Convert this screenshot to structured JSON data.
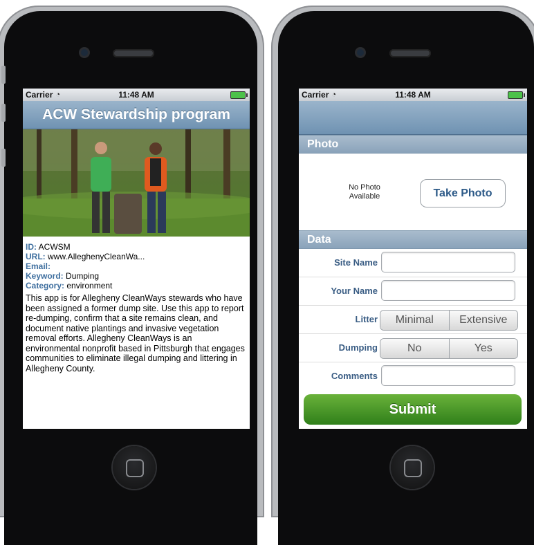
{
  "left_screen": {
    "status": {
      "carrier": "Carrier",
      "time": "11:48 AM"
    },
    "nav_title": "ACW Stewardship program",
    "info": {
      "id_label": "ID:",
      "id_value": "ACWSM",
      "url_label": "URL:",
      "url_value": "www.AlleghenyCleanWa...",
      "email_label": "Email:",
      "email_value": "",
      "keyword_label": "Keyword:",
      "keyword_value": "Dumping",
      "category_label": "Category:",
      "category_value": "environment"
    },
    "description": "This app is for Allegheny CleanWays stewards who have been assigned a former dump site. Use this app to report re-dumping, confirm that a site remains clean, and document native plantings and invasive vegetation removal efforts. Allegheny CleanWays is an environmental nonprofit based in Pittsburgh that engages communities to eliminate illegal dumping and littering in Allegheny County."
  },
  "right_screen": {
    "status": {
      "carrier": "Carrier",
      "time": "11:48 AM"
    },
    "photo_section": "Photo",
    "no_photo_text": "No Photo Available",
    "take_photo_label": "Take Photo",
    "data_section": "Data",
    "fields": {
      "site_name_label": "Site Name",
      "your_name_label": "Your Name",
      "litter_label": "Litter",
      "litter_options": [
        "Minimal",
        "Extensive"
      ],
      "dumping_label": "Dumping",
      "dumping_options": [
        "No",
        "Yes"
      ],
      "comments_label": "Comments"
    },
    "submit_label": "Submit"
  },
  "colors": {
    "nav_blue": "#7f9fbd",
    "label_blue": "#3a5d84",
    "submit_green": "#4a9a2a"
  }
}
